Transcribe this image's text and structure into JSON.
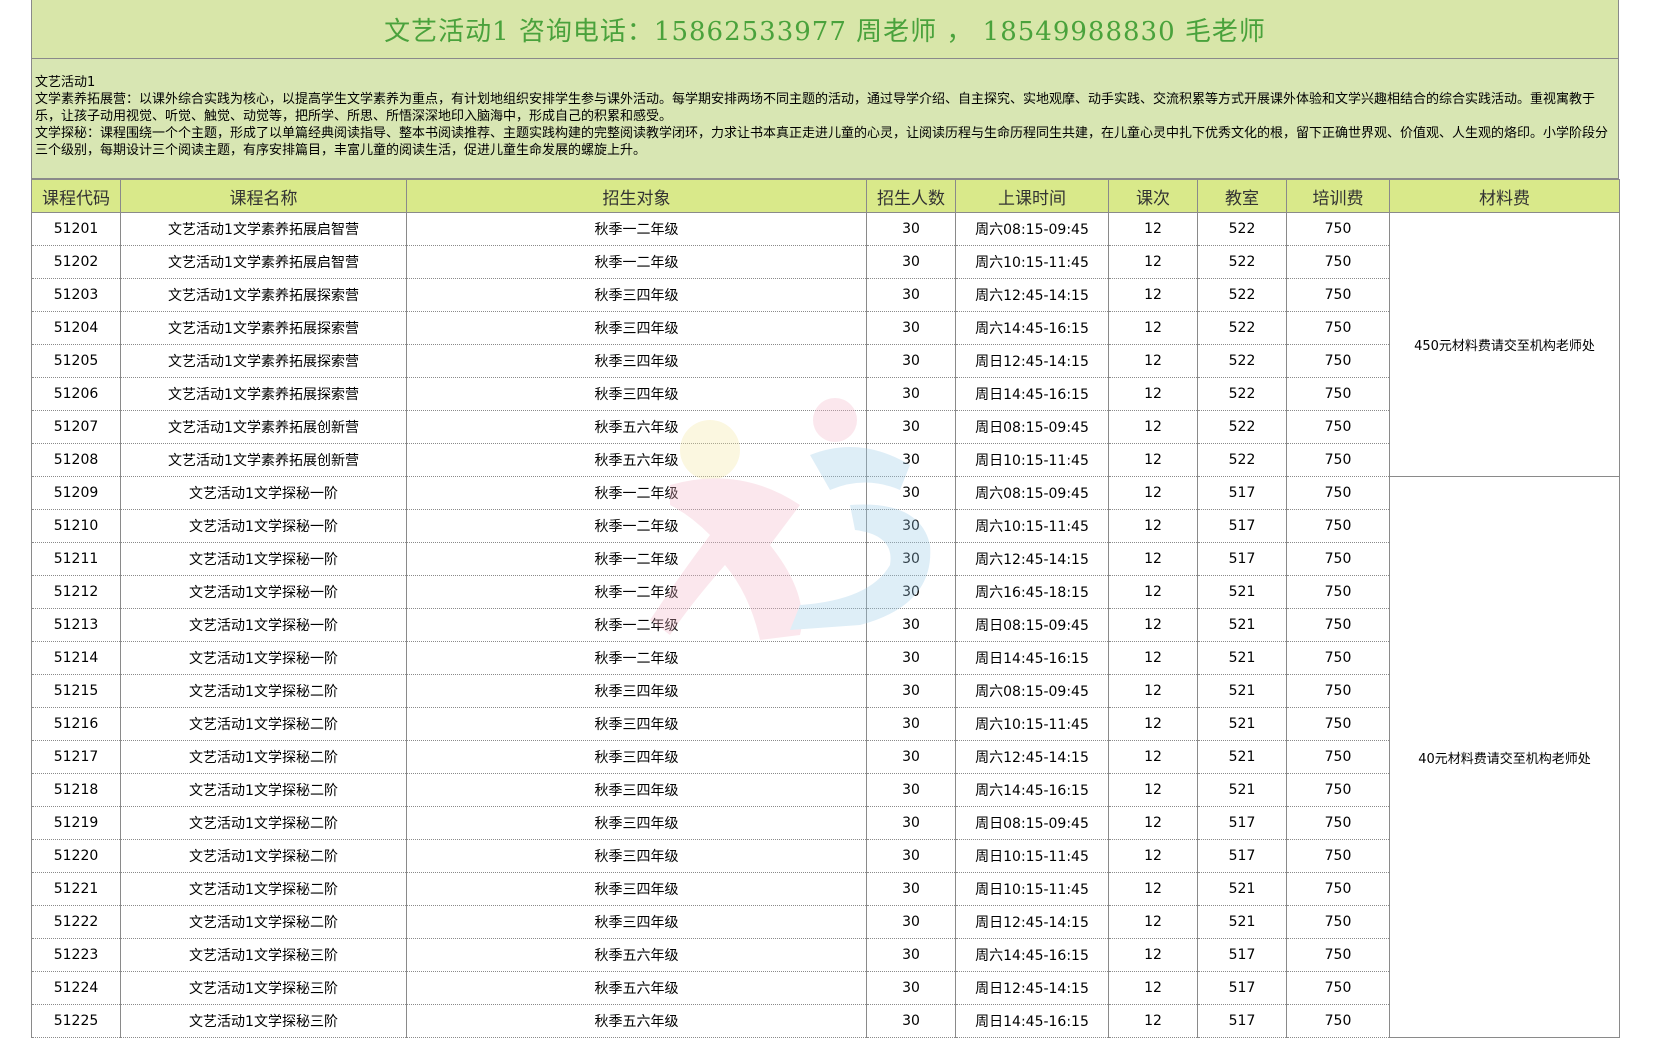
{
  "header": {
    "title": "文艺活动1  咨询电话：15862533977  周老师 ，  18549988830  毛老师"
  },
  "intro": {
    "line1": "文艺活动1",
    "line2": "文学素养拓展营：以课外综合实践为核心，以提高学生文学素养为重点，有计划地组织安排学生参与课外活动。每学期安排两场不同主题的活动，通过导学介绍、自主探究、实地观摩、动手实践、交流积累等方式开展课外体验和文学兴趣相结合的综合实践活动。重视寓教于乐，让孩子动用视觉、听觉、触觉、动觉等，把所学、所思、所悟深深地印入脑海中，形成自己的积累和感受。",
    "line3": "文学探秘：课程围绕一个个主题，形成了以单篇经典阅读指导、整本书阅读推荐、主题实践构建的完整阅读教学闭环，力求让书本真正走进儿童的心灵，让阅读历程与生命历程同生共建，在儿童心灵中扎下优秀文化的根，留下正确世界观、价值观、人生观的烙印。小学阶段分三个级别，每期设计三个阅读主题，有序安排篇目，丰富儿童的阅读生活，促进儿童生命发展的螺旋上升。"
  },
  "table": {
    "headers": [
      "课程代码",
      "课程名称",
      "招生对象",
      "招生人数",
      "上课时间",
      "课次",
      "教室",
      "培训费",
      "材料费"
    ],
    "rows": [
      [
        "51201",
        "文艺活动1文学素养拓展启智营",
        "秋季一二年级",
        "30",
        "周六08:15-09:45",
        "12",
        "522",
        "750"
      ],
      [
        "51202",
        "文艺活动1文学素养拓展启智营",
        "秋季一二年级",
        "30",
        "周六10:15-11:45",
        "12",
        "522",
        "750"
      ],
      [
        "51203",
        "文艺活动1文学素养拓展探索营",
        "秋季三四年级",
        "30",
        "周六12:45-14:15",
        "12",
        "522",
        "750"
      ],
      [
        "51204",
        "文艺活动1文学素养拓展探索营",
        "秋季三四年级",
        "30",
        "周六14:45-16:15",
        "12",
        "522",
        "750"
      ],
      [
        "51205",
        "文艺活动1文学素养拓展探索营",
        "秋季三四年级",
        "30",
        "周日12:45-14:15",
        "12",
        "522",
        "750"
      ],
      [
        "51206",
        "文艺活动1文学素养拓展探索营",
        "秋季三四年级",
        "30",
        "周日14:45-16:15",
        "12",
        "522",
        "750"
      ],
      [
        "51207",
        "文艺活动1文学素养拓展创新营",
        "秋季五六年级",
        "30",
        "周日08:15-09:45",
        "12",
        "522",
        "750"
      ],
      [
        "51208",
        "文艺活动1文学素养拓展创新营",
        "秋季五六年级",
        "30",
        "周日10:15-11:45",
        "12",
        "522",
        "750"
      ],
      [
        "51209",
        "文艺活动1文学探秘一阶",
        "秋季一二年级",
        "30",
        "周六08:15-09:45",
        "12",
        "517",
        "750"
      ],
      [
        "51210",
        "文艺活动1文学探秘一阶",
        "秋季一二年级",
        "30",
        "周六10:15-11:45",
        "12",
        "517",
        "750"
      ],
      [
        "51211",
        "文艺活动1文学探秘一阶",
        "秋季一二年级",
        "30",
        "周六12:45-14:15",
        "12",
        "517",
        "750"
      ],
      [
        "51212",
        "文艺活动1文学探秘一阶",
        "秋季一二年级",
        "30",
        "周六16:45-18:15",
        "12",
        "521",
        "750"
      ],
      [
        "51213",
        "文艺活动1文学探秘一阶",
        "秋季一二年级",
        "30",
        "周日08:15-09:45",
        "12",
        "521",
        "750"
      ],
      [
        "51214",
        "文艺活动1文学探秘一阶",
        "秋季一二年级",
        "30",
        "周日14:45-16:15",
        "12",
        "521",
        "750"
      ],
      [
        "51215",
        "文艺活动1文学探秘二阶",
        "秋季三四年级",
        "30",
        "周六08:15-09:45",
        "12",
        "521",
        "750"
      ],
      [
        "51216",
        "文艺活动1文学探秘二阶",
        "秋季三四年级",
        "30",
        "周六10:15-11:45",
        "12",
        "521",
        "750"
      ],
      [
        "51217",
        "文艺活动1文学探秘二阶",
        "秋季三四年级",
        "30",
        "周六12:45-14:15",
        "12",
        "521",
        "750"
      ],
      [
        "51218",
        "文艺活动1文学探秘二阶",
        "秋季三四年级",
        "30",
        "周六14:45-16:15",
        "12",
        "521",
        "750"
      ],
      [
        "51219",
        "文艺活动1文学探秘二阶",
        "秋季三四年级",
        "30",
        "周日08:15-09:45",
        "12",
        "517",
        "750"
      ],
      [
        "51220",
        "文艺活动1文学探秘二阶",
        "秋季三四年级",
        "30",
        "周日10:15-11:45",
        "12",
        "517",
        "750"
      ],
      [
        "51221",
        "文艺活动1文学探秘二阶",
        "秋季三四年级",
        "30",
        "周日10:15-11:45",
        "12",
        "521",
        "750"
      ],
      [
        "51222",
        "文艺活动1文学探秘二阶",
        "秋季三四年级",
        "30",
        "周日12:45-14:15",
        "12",
        "521",
        "750"
      ],
      [
        "51223",
        "文艺活动1文学探秘三阶",
        "秋季五六年级",
        "30",
        "周六14:45-16:15",
        "12",
        "517",
        "750"
      ],
      [
        "51224",
        "文艺活动1文学探秘三阶",
        "秋季五六年级",
        "30",
        "周日12:45-14:15",
        "12",
        "517",
        "750"
      ],
      [
        "51225",
        "文艺活动1文学探秘三阶",
        "秋季五六年级",
        "30",
        "周日14:45-16:15",
        "12",
        "517",
        "750"
      ]
    ],
    "notes": [
      {
        "text": "450元材料费请交至机构老师处",
        "rowspan": 8
      },
      {
        "text": "40元材料费请交至机构老师处",
        "rowspan": 17
      }
    ]
  },
  "watermark": {
    "icon": "logo-watermark-icon",
    "colors": [
      "#f4b8c8",
      "#9ccbe8",
      "#f5e7a0"
    ]
  }
}
